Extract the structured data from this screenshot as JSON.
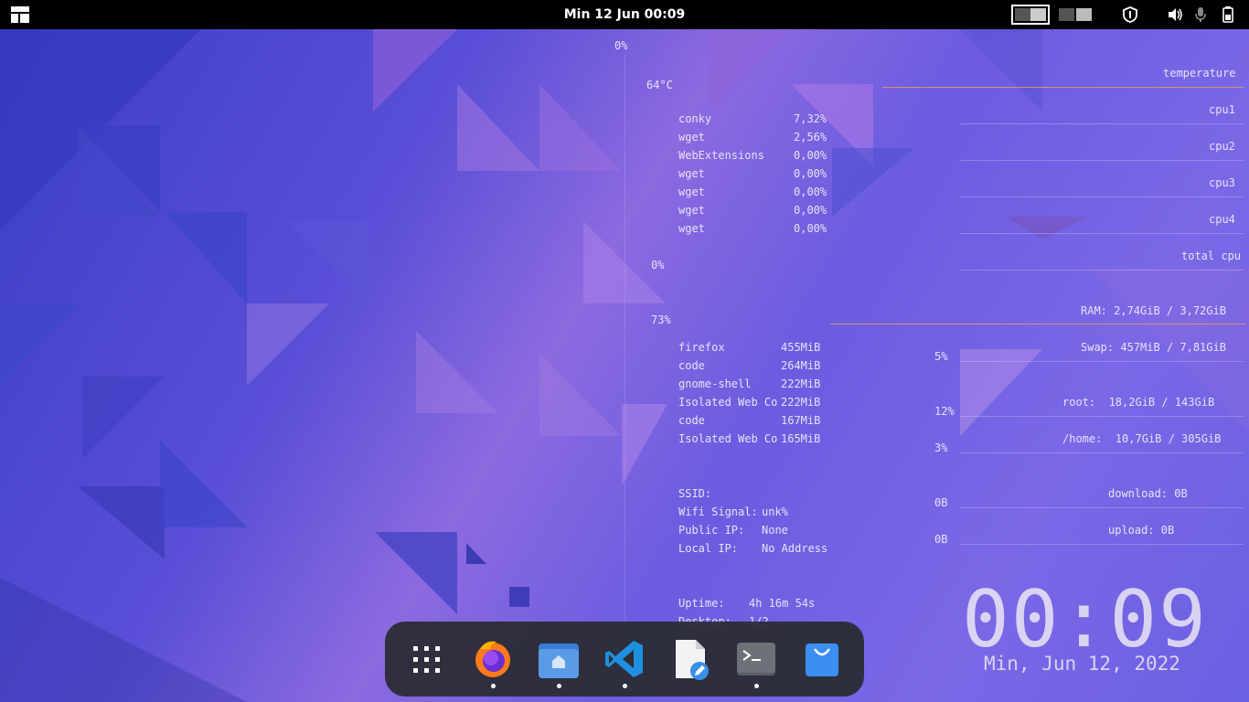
{
  "topbar": {
    "clock": "Min 12 Jun  00:09"
  },
  "conky": {
    "cpu_top_pct": "0%",
    "temperature_value": "64°C",
    "cpu_bottom_pct": "0%",
    "mem_pct": "73%",
    "labels": {
      "temperature": "temperature",
      "cpu1": "cpu1",
      "cpu2": "cpu2",
      "cpu3": "cpu3",
      "cpu4": "cpu4",
      "total_cpu": "total cpu",
      "ram": "RAM: 2,74GiB / 3,72GiB",
      "swap": "Swap: 457MiB / 7,81GiB",
      "root": "root:  18,2GiB / 143GiB",
      "home": "/home:  10,7GiB / 305GiB",
      "download": "download: 0B",
      "upload": "upload: 0B"
    },
    "disk_values": {
      "swap_pct": "5%",
      "root_pct": "12%",
      "home_pct": "3%",
      "download_val": "0B",
      "upload_val": "0B"
    },
    "cpu_processes": [
      {
        "name": "conky",
        "value": "7,32%"
      },
      {
        "name": "wget",
        "value": "2,56%"
      },
      {
        "name": "WebExtensions",
        "value": "0,00%"
      },
      {
        "name": "wget",
        "value": "0,00%"
      },
      {
        "name": "wget",
        "value": "0,00%"
      },
      {
        "name": "wget",
        "value": "0,00%"
      },
      {
        "name": "wget",
        "value": "0,00%"
      }
    ],
    "mem_processes": [
      {
        "name": "firefox",
        "value": "455MiB"
      },
      {
        "name": "code",
        "value": "264MiB"
      },
      {
        "name": "gnome-shell",
        "value": "222MiB"
      },
      {
        "name": "Isolated Web Co",
        "value": "222MiB"
      },
      {
        "name": "code",
        "value": "167MiB"
      },
      {
        "name": "Isolated Web Co",
        "value": "165MiB"
      }
    ],
    "network": [
      {
        "label": "SSID:",
        "value": ""
      },
      {
        "label": "Wifi Signal:",
        "value": "unk%"
      },
      {
        "label": "Public IP:",
        "value": "None"
      },
      {
        "label": "Local IP:",
        "value": "No Address"
      }
    ],
    "uptime_label": "Uptime:",
    "uptime_value": "4h 16m 54s",
    "desktop_label": "Desktop:",
    "desktop_value": "1/2",
    "big_clock": "00:09",
    "big_date": "Min, Jun 12, 2022"
  },
  "dock": {
    "items": [
      "app-grid",
      "firefox",
      "files",
      "vscode",
      "text-editor",
      "terminal",
      "software-center"
    ]
  },
  "colors": {
    "topbar": "#000000",
    "dock": "#282a30",
    "accent_line": "#e8a05a"
  }
}
